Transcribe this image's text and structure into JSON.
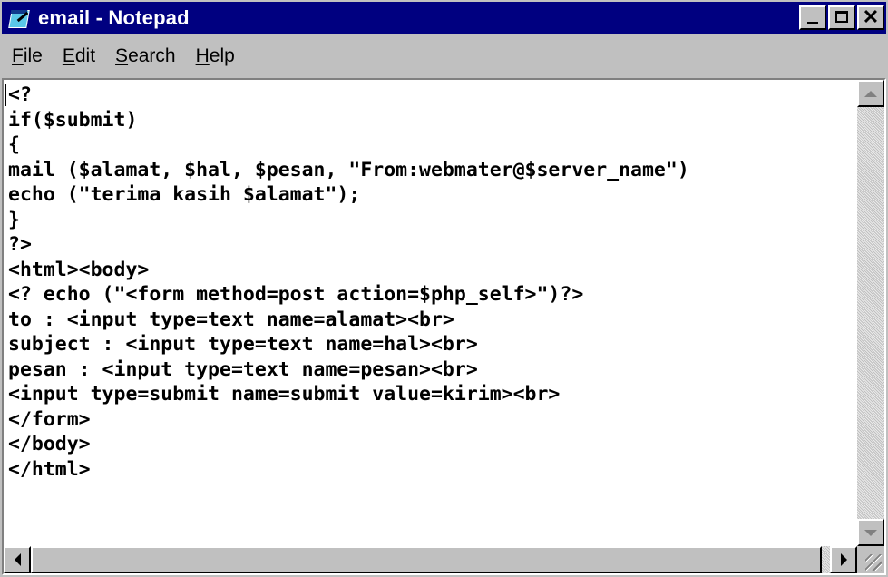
{
  "window": {
    "title": "email - Notepad"
  },
  "title_buttons": {
    "close_label": "✕"
  },
  "menu": [
    {
      "accel": "F",
      "rest": "ile"
    },
    {
      "accel": "E",
      "rest": "dit"
    },
    {
      "accel": "S",
      "rest": "earch"
    },
    {
      "accel": "H",
      "rest": "elp"
    }
  ],
  "editor": {
    "lines": [
      "<?",
      "if($submit)",
      "{",
      "mail ($alamat, $hal, $pesan, \"From:webmater@$server_name\")",
      "echo (\"terima kasih $alamat\");",
      "}",
      "?>",
      "<html><body>",
      "<? echo (\"<form method=post action=$php_self>\")?>",
      "to : <input type=text name=alamat><br>",
      "subject : <input type=text name=hal><br>",
      "pesan : <input type=text name=pesan><br>",
      "<input type=submit name=submit value=kirim><br>",
      "</form>",
      "</body>",
      "</html>"
    ]
  },
  "icons": {
    "app": "notepad-icon",
    "minimize": "minimize-icon",
    "maximize": "maximize-icon",
    "close": "close-icon",
    "scroll_up": "arrow-up-icon",
    "scroll_down": "arrow-down-icon",
    "scroll_left": "arrow-left-icon",
    "scroll_right": "arrow-right-icon"
  },
  "colors": {
    "titlebar": "#000080",
    "chrome": "#c0c0c0",
    "editor_bg": "#ffffff"
  }
}
